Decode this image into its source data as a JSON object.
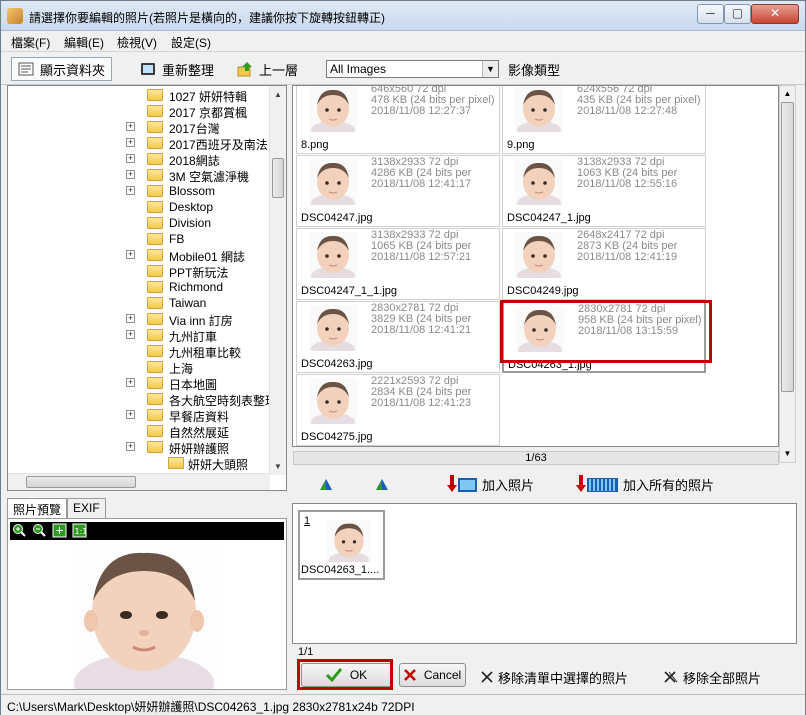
{
  "window": {
    "title": "請選擇你要編輯的照片(若照片是橫向的，建議你按下旋轉按鈕轉正)",
    "min_label": "─",
    "max_label": "▢",
    "close_label": "✕"
  },
  "menu": [
    "檔案(F)",
    "編輯(E)",
    "檢視(V)",
    "設定(S)"
  ],
  "toolbar": {
    "show_folders": "顯示資料夾",
    "refresh": "重新整理",
    "up_level": "上一層",
    "filter_value": "All Images",
    "image_type_label": "影像類型"
  },
  "folder_tree": [
    {
      "label": "1027 妍妍特輯",
      "expander": false
    },
    {
      "label": "2017 京都賞楓",
      "expander": false
    },
    {
      "label": "2017台灣",
      "expander": true
    },
    {
      "label": "2017西班牙及南法",
      "expander": true
    },
    {
      "label": "2018網誌",
      "expander": true
    },
    {
      "label": "3M 空氣濾淨機",
      "expander": true
    },
    {
      "label": "Blossom",
      "expander": true
    },
    {
      "label": "Desktop",
      "expander": false
    },
    {
      "label": "Division",
      "expander": false
    },
    {
      "label": "FB",
      "expander": false
    },
    {
      "label": "Mobile01 網誌",
      "expander": true
    },
    {
      "label": "PPT新玩法",
      "expander": false
    },
    {
      "label": "Richmond",
      "expander": false
    },
    {
      "label": "Taiwan",
      "expander": false
    },
    {
      "label": "Via inn 訂房",
      "expander": true
    },
    {
      "label": "九州訂車",
      "expander": true
    },
    {
      "label": "九州租車比較",
      "expander": false
    },
    {
      "label": "上海",
      "expander": false
    },
    {
      "label": "日本地圖",
      "expander": true
    },
    {
      "label": "各大航空時刻表整理",
      "expander": false
    },
    {
      "label": "早餐店資料",
      "expander": true
    },
    {
      "label": "自然然展延",
      "expander": false
    },
    {
      "label": "妍妍辦護照",
      "expander": true
    },
    {
      "label": "妍妍大頭照",
      "expander": false
    }
  ],
  "preview_tabs": {
    "preview": "照片預覽",
    "exif": "EXIF"
  },
  "thumbnails": [
    {
      "dims": "646x560 72 dpi",
      "size": "478 KB (24 bits per pixel)",
      "date": "2018/11/08 12:27:37",
      "name": "8.png"
    },
    {
      "dims": "624x556 72 dpi",
      "size": "435 KB (24 bits per pixel)",
      "date": "2018/11/08 12:27:48",
      "name": "9.png"
    },
    {
      "dims": "3138x2933 72 dpi",
      "size": "4286 KB (24 bits per",
      "date": "2018/11/08 12:41:17",
      "name": "DSC04247.jpg"
    },
    {
      "dims": "3138x2933 72 dpi",
      "size": "1063 KB (24 bits per",
      "date": "2018/11/08 12:55:16",
      "name": "DSC04247_1.jpg"
    },
    {
      "dims": "3138x2933 72 dpi",
      "size": "1065 KB (24 bits per",
      "date": "2018/11/08 12:57:21",
      "name": "DSC04247_1_1.jpg"
    },
    {
      "dims": "2648x2417 72 dpi",
      "size": "2873 KB (24 bits per",
      "date": "2018/11/08 12:41:19",
      "name": "DSC04249.jpg"
    },
    {
      "dims": "2830x2781 72 dpi",
      "size": "3829 KB (24 bits per",
      "date": "2018/11/08 12:41:21",
      "name": "DSC04263.jpg"
    },
    {
      "dims": "2830x2781 72 dpi",
      "size": "958 KB (24 bits per pixel)",
      "date": "2018/11/08 13:15:59",
      "name": "DSC04263_1.jpg"
    },
    {
      "dims": "2221x2593 72 dpi",
      "size": "2834 KB (24 bits per",
      "date": "2018/11/08 12:41:23",
      "name": "DSC04275.jpg"
    }
  ],
  "pager": "1/63",
  "add_actions": {
    "add_photo": "加入照片",
    "add_all": "加入所有的照片"
  },
  "selected_items": [
    {
      "number": "1",
      "name": "DSC04263_1...."
    }
  ],
  "selected_count": "1/1",
  "buttons": {
    "ok": "OK",
    "cancel": "Cancel",
    "remove_selected": "移除清單中選擇的照片",
    "remove_all": "移除全部照片"
  },
  "status": "C:\\Users\\Mark\\Desktop\\妍妍辦護照\\DSC04263_1.jpg   2830x2781x24b   72DPI",
  "colors": {
    "highlight_border": "#c00000",
    "ok_check": "#2e9a1f"
  }
}
